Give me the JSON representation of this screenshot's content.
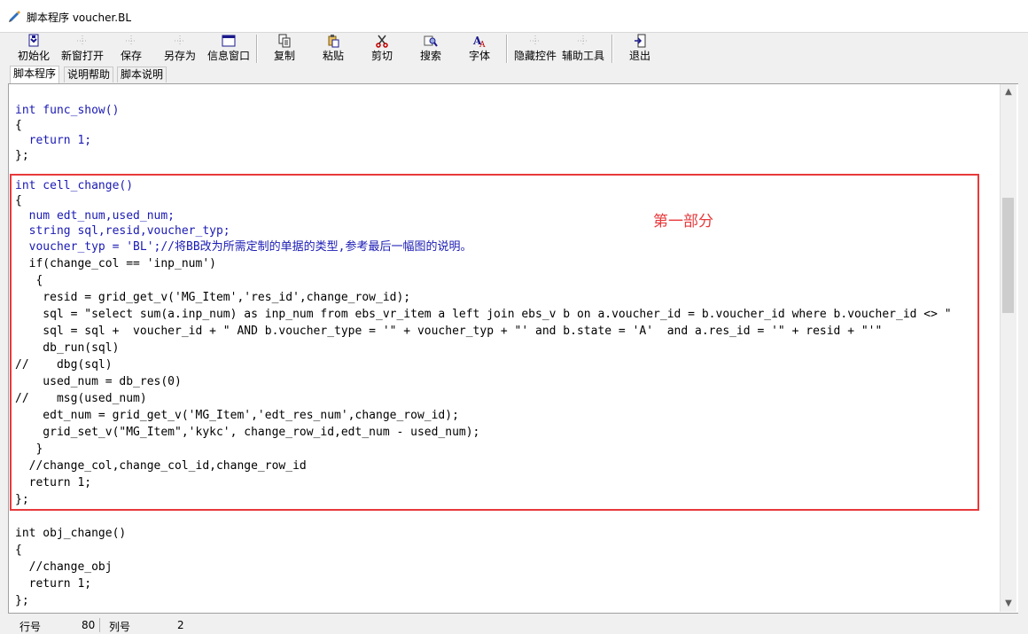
{
  "window": {
    "title": "脚本程序  voucher.BL",
    "icon": "script-app-icon"
  },
  "toolbar": {
    "buttons": [
      {
        "label": "初始化",
        "icon": "init-icon"
      },
      {
        "label": "新窗打开",
        "icon": "new-window-icon"
      },
      {
        "label": "保存",
        "icon": "save-icon"
      },
      {
        "label": "另存为",
        "icon": "save-as-icon"
      },
      {
        "label": "信息窗口",
        "icon": "info-window-icon"
      },
      {
        "label": "复制",
        "icon": "copy-icon"
      },
      {
        "label": "粘贴",
        "icon": "paste-icon"
      },
      {
        "label": "剪切",
        "icon": "cut-icon"
      },
      {
        "label": "搜索",
        "icon": "search-icon"
      },
      {
        "label": "字体",
        "icon": "font-icon"
      },
      {
        "label": "隐藏控件",
        "icon": "hide-controls-icon"
      },
      {
        "label": "辅助工具",
        "icon": "helper-tools-icon"
      },
      {
        "label": "退出",
        "icon": "exit-icon"
      }
    ]
  },
  "tabs": [
    {
      "label": "脚本程序",
      "active": true
    },
    {
      "label": "说明帮助",
      "active": false
    },
    {
      "label": "脚本说明",
      "active": false
    }
  ],
  "editor": {
    "lines": [
      "int func_show()",
      "{",
      "  return 1;",
      "};",
      "int cell_change()",
      "{",
      "  num edt_num,used_num;",
      "  string sql,resid,voucher_typ;",
      "  voucher_typ = 'BL';//将BB改为所需定制的单据的类型,参考最后一幅图的说明。",
      "  if(change_col == 'inp_num')",
      "   {",
      "    resid = grid_get_v('MG_Item','res_id',change_row_id);",
      "    sql = \"select sum(a.inp_num) as inp_num from ebs_vr_item a left join ebs_v b on a.voucher_id = b.voucher_id where b.voucher_id <> \"",
      "    sql = sql +  voucher_id + \" AND b.voucher_type = '\" + voucher_typ + \"' and b.state = 'A'  and a.res_id = '\" + resid + \"'\"",
      "    db_run(sql)",
      "//    dbg(sql)",
      "    used_num = db_res(0)",
      "//    msg(used_num)",
      "    edt_num = grid_get_v('MG_Item','edt_res_num',change_row_id);",
      "    grid_set_v(\"MG_Item\",'kykc', change_row_id,edt_num - used_num);",
      "   }",
      "  //change_col,change_col_id,change_row_id",
      "  return 1;",
      "};",
      "int obj_change()",
      "{",
      "  //change_obj",
      "  return 1;",
      "};"
    ],
    "annotation": "第一部分",
    "highlight_color": "#e8393b"
  },
  "statusbar": {
    "row_label": "行号",
    "row_value": "80",
    "col_label": "列号",
    "col_value": "2"
  }
}
